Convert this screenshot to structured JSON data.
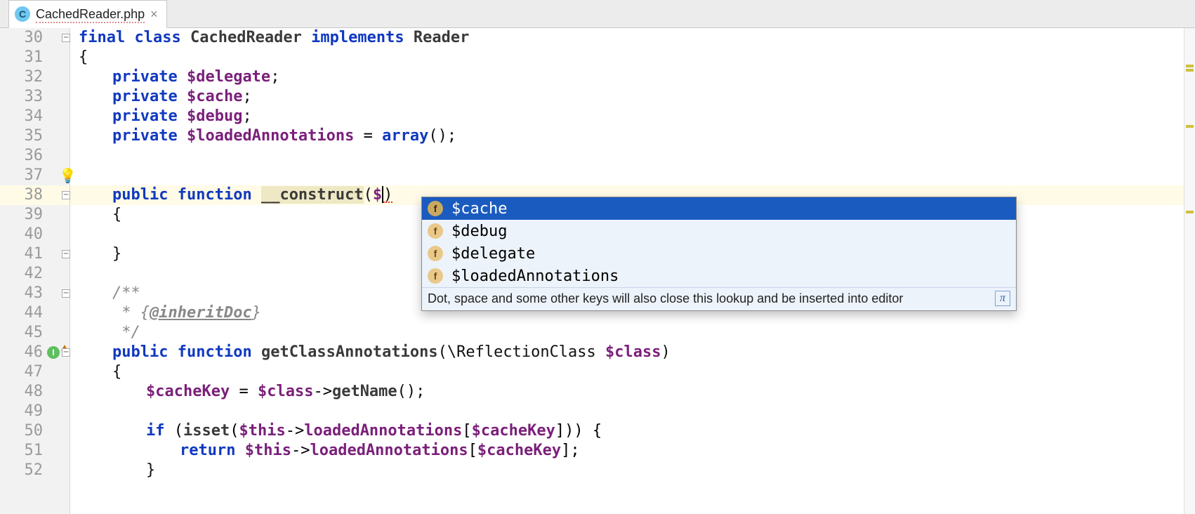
{
  "tab": {
    "filename": "CachedReader.php",
    "file_icon_letter": "C"
  },
  "lines": [
    "30",
    "31",
    "32",
    "33",
    "34",
    "35",
    "36",
    "37",
    "38",
    "39",
    "40",
    "41",
    "42",
    "43",
    "44",
    "45",
    "46",
    "47",
    "48",
    "49",
    "50",
    "51",
    "52"
  ],
  "code": {
    "l30_kw1": "final",
    "l30_kw2": "class",
    "l30_name": "CachedReader",
    "l30_kw3": "implements",
    "l30_iface": "Reader",
    "l31_open": "{",
    "l32_kw": "private",
    "l32_var": "$delegate",
    "l32_end": ";",
    "l33_kw": "private",
    "l33_var": "$cache",
    "l33_end": ";",
    "l34_kw": "private",
    "l34_var": "$debug",
    "l34_end": ";",
    "l35_kw": "private",
    "l35_var": "$loadedAnnotations",
    "l35_eq": " = ",
    "l35_fn": "array",
    "l35_end": "();",
    "l38_kw1": "public",
    "l38_kw2": "function",
    "l38_name": "__construct",
    "l38_pre": "(",
    "l38_dollar": "$",
    "l38_post": ")",
    "l39_open": "{",
    "l41_close": "}",
    "l43_doc": "/**",
    "l44_doc_pre": " * {",
    "l44_tag": "@inheritDoc",
    "l44_doc_post": "}",
    "l45_doc": " */",
    "l46_kw1": "public",
    "l46_kw2": "function",
    "l46_name": "getClassAnnotations",
    "l46_sig": "(\\ReflectionClass ",
    "l46_var": "$class",
    "l46_post": ")",
    "l47_open": "{",
    "l48_var1": "$cacheKey",
    "l48_eq": " = ",
    "l48_var2": "$class",
    "l48_arrow": "->",
    "l48_m": "getName",
    "l48_end": "();",
    "l50_kw": "if",
    "l50_p1": " (",
    "l50_isset": "isset",
    "l50_p2": "(",
    "l50_this": "$this",
    "l50_arrow": "->",
    "l50_f": "loadedAnnotations",
    "l50_b1": "[",
    "l50_key": "$cacheKey",
    "l50_b2": "])) {",
    "l51_kw": "return",
    "l51_sp": " ",
    "l51_this": "$this",
    "l51_arrow": "->",
    "l51_f": "loadedAnnotations",
    "l51_b1": "[",
    "l51_key": "$cacheKey",
    "l51_b2": "];",
    "l52_close": "}"
  },
  "autocomplete": {
    "items": [
      {
        "icon": "f",
        "label": "$cache",
        "selected": true
      },
      {
        "icon": "f",
        "label": "$debug"
      },
      {
        "icon": "f",
        "label": "$delegate"
      },
      {
        "icon": "f",
        "label": "$loadedAnnotations"
      }
    ],
    "hint": "Dot, space and some other keys will also close this lookup and be inserted into editor",
    "pi": "π"
  },
  "bulb": "💡"
}
